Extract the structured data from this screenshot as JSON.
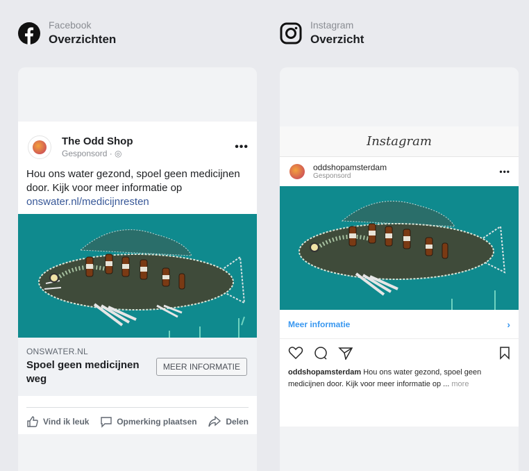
{
  "facebook": {
    "platform": "Facebook",
    "section_title": "Overzichten",
    "page_name": "The Odd Shop",
    "sponsored": "Gesponsord",
    "post_text": "Hou ons water gezond, spoel geen medicijnen door. Kijk voor meer informatie op",
    "post_link": "onswater.nl/medicijnresten",
    "cta_domain": "ONSWATER.NL",
    "cta_title": "Spoel geen medicijnen weg",
    "cta_button": "MEER INFORMATIE",
    "actions": {
      "like": "Vind ik leuk",
      "comment": "Opmerking plaatsen",
      "share": "Delen"
    },
    "more_menu": "•••"
  },
  "instagram": {
    "platform": "Instagram",
    "section_title": "Overzicht",
    "wordmark": "Instagram",
    "username": "oddshopamsterdam",
    "sponsored": "Gesponsord",
    "more_info": "Meer informatie",
    "chevron": "›",
    "caption_user": "oddshopamsterdam",
    "caption_text": " Hou ons water gezond, spoel geen medicijnen door. Kijk voor meer informatie op ... ",
    "caption_more": "more",
    "more_menu": "•••"
  },
  "colors": {
    "fb_link": "#385898",
    "ig_link": "#3897f0",
    "image_bg": "#0f8a8e"
  }
}
